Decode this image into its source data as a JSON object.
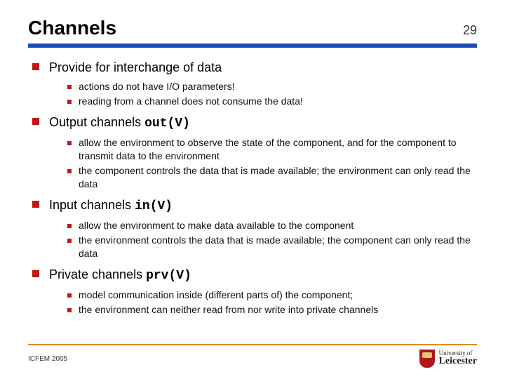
{
  "header": {
    "title": "Channels",
    "page": "29"
  },
  "sections": [
    {
      "heading": "Provide for interchange of data",
      "code": "",
      "points": [
        "actions do not have I/O parameters!",
        "reading from a channel does not consume the data!"
      ]
    },
    {
      "heading": "Output channels ",
      "code": "out(V)",
      "points": [
        "allow the environment to observe the state of the component, and for the component to transmit data to the environment",
        "the component controls the data that is made available; the environment can only read the data"
      ]
    },
    {
      "heading": "Input channels ",
      "code": "in(V)",
      "points": [
        "allow the environment to make data available to the component",
        "the environment controls the data that is made available; the component can only read the data"
      ]
    },
    {
      "heading": "Private channels ",
      "code": "prv(V)",
      "points": [
        "model communication inside (different parts of) the component;",
        "the environment can neither read from nor write into private channels"
      ]
    }
  ],
  "footer": {
    "conference": "ICFEM 2005",
    "affiliation_top": "University of",
    "affiliation_bottom": "Leicester"
  }
}
